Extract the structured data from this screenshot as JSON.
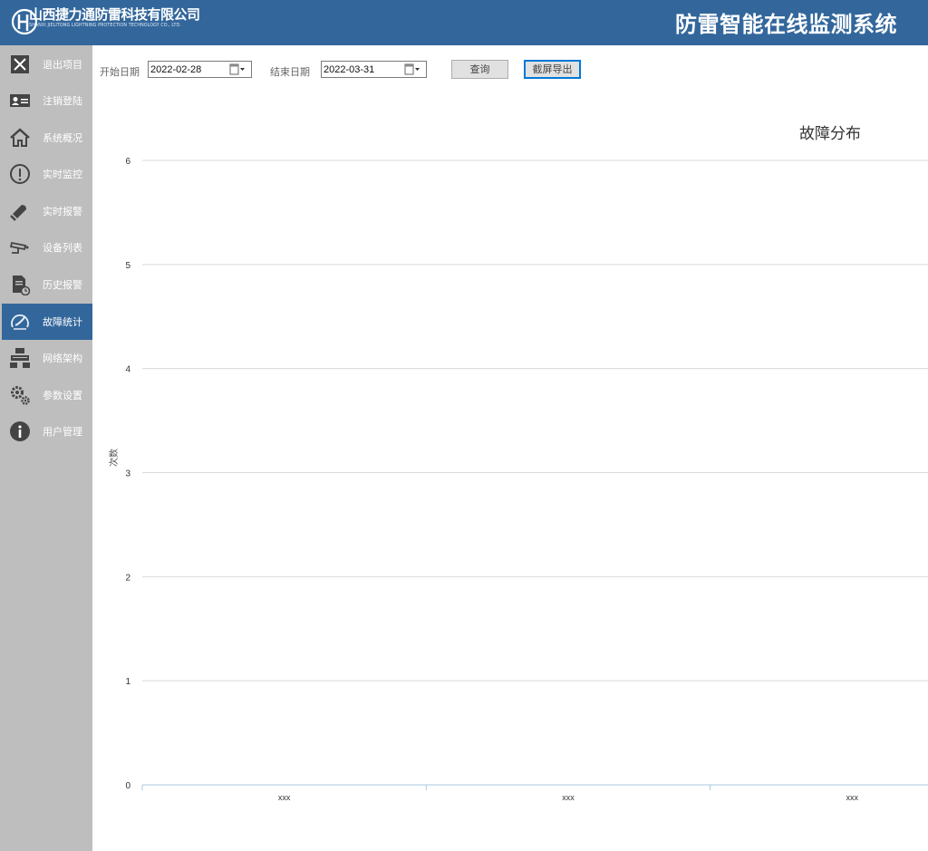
{
  "header": {
    "company_cn": "山西捷力通防雷科技有限公司",
    "company_en": "SHANXI JIELITONG LIGHTNING PROTECTION TECHNOLOGY CO., LTD.",
    "system_title": "防雷智能在线监测系统",
    "color": "#33679c"
  },
  "sidebar": {
    "items": [
      {
        "label": "退出项目",
        "icon": "close-box-icon"
      },
      {
        "label": "注销登陆",
        "icon": "id-card-icon"
      },
      {
        "label": "系统概况",
        "icon": "home-icon"
      },
      {
        "label": "实时监控",
        "icon": "info-circle-icon"
      },
      {
        "label": "实时报警",
        "icon": "bell-icon"
      },
      {
        "label": "设备列表",
        "icon": "camera-icon"
      },
      {
        "label": "历史报警",
        "icon": "document-clock-icon"
      },
      {
        "label": "故障统计",
        "icon": "gauge-icon",
        "active": true
      },
      {
        "label": "网络架构",
        "icon": "network-icon"
      },
      {
        "label": "参数设置",
        "icon": "gears-icon"
      },
      {
        "label": "用户管理",
        "icon": "info-icon"
      }
    ]
  },
  "toolbar": {
    "start_label": "开始日期",
    "start_value": "2022-02-28",
    "end_label": "结束日期",
    "end_value": "2022-03-31",
    "query_label": "查询",
    "export_label": "截屏导出"
  },
  "chart_data": {
    "type": "bar",
    "title": "故障分布",
    "ylabel": "次数",
    "xlabel": "",
    "categories": [
      "xxx",
      "xxx",
      "xxx"
    ],
    "values": [
      0,
      0,
      0
    ],
    "ylim": [
      0,
      6
    ],
    "yticks": [
      0,
      1,
      2,
      3,
      4,
      5,
      6
    ],
    "grid": true
  }
}
